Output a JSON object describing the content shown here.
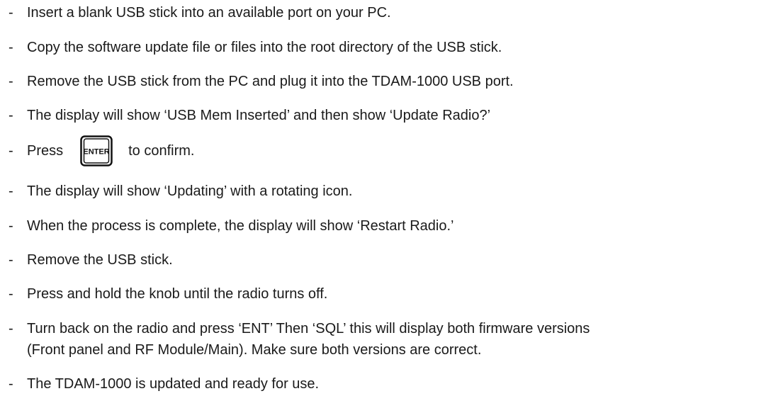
{
  "steps": [
    {
      "dash": "-",
      "text": "Insert a blank USB stick into an available port on your PC."
    },
    {
      "dash": "-",
      "text": "Copy the software update file or files into the root directory of the USB stick."
    },
    {
      "dash": "-",
      "text": "Remove the USB stick from the PC and plug it into the TDAM-1000 USB port."
    },
    {
      "dash": "-",
      "text": "The display will show ‘USB Mem Inserted’ and then show ‘Update Radio?’"
    },
    {
      "dash": "-",
      "before": "Press",
      "key_label": "ENTER",
      "key_icon": "enter-key-icon",
      "after": "to confirm."
    },
    {
      "dash": "-",
      "text": "The display will show ‘Updating’ with a rotating icon."
    },
    {
      "dash": "-",
      "text": "When the process is complete, the display will show ‘Restart Radio.’"
    },
    {
      "dash": "-",
      "text": "Remove the USB stick."
    },
    {
      "dash": "-",
      "text": "Press and hold the knob until the radio turns off."
    },
    {
      "dash": "-",
      "line1": "Turn back on the radio and press ‘ENT’ Then ‘SQL’ this will display both firmware versions",
      "line2": "(Front panel and RF Module/Main). Make sure both versions are correct."
    },
    {
      "dash": "-",
      "text": "The TDAM-1000 is updated and ready for use."
    }
  ]
}
